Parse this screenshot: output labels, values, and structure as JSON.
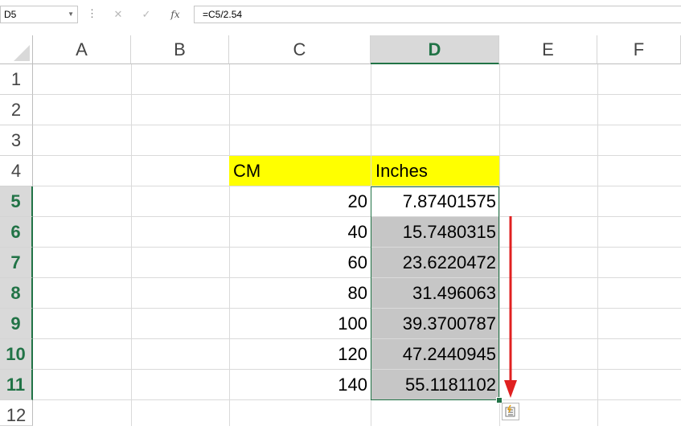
{
  "formula_bar": {
    "name_box": "D5",
    "more": "⋮",
    "cancel_icon": "✕",
    "enter_icon": "✓",
    "fx_label": "fx",
    "formula": "=C5/2.54"
  },
  "columns": [
    "A",
    "B",
    "C",
    "D",
    "E",
    "F"
  ],
  "selected_column": "D",
  "rows": [
    "1",
    "2",
    "3",
    "4",
    "5",
    "6",
    "7",
    "8",
    "9",
    "10",
    "11",
    "12"
  ],
  "selected_rows": [
    "5",
    "6",
    "7",
    "8",
    "9",
    "10",
    "11"
  ],
  "table": {
    "header_cm": "CM",
    "header_inches": "Inches",
    "cm_values": [
      "20",
      "40",
      "60",
      "80",
      "100",
      "120",
      "140"
    ],
    "inch_values": [
      "7.87401575",
      "15.7480315",
      "23.6220472",
      "31.496063",
      "39.3700787",
      "47.2440945",
      "55.1181102"
    ]
  },
  "colors": {
    "header_fill": "#ffff00",
    "selection_green": "#217346",
    "annotation_arrow": "#e02020"
  },
  "icons": {
    "flash_fill": "flash-fill-options-icon",
    "arrow": "red-down-arrow"
  }
}
